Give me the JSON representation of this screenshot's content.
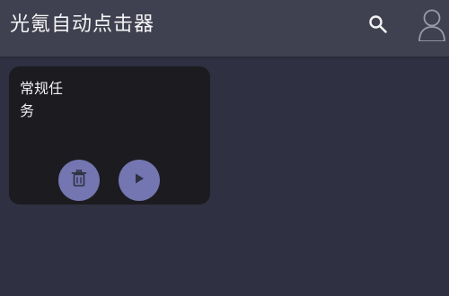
{
  "appbar": {
    "title": "光氪自动点击器",
    "search_icon": "search-icon",
    "account_icon": "account-icon"
  },
  "tasks": [
    {
      "title": "常规任务",
      "actions": [
        "delete-icon",
        "play-icon"
      ]
    }
  ],
  "colors": {
    "background": "#2f3041",
    "appbar": "#404150",
    "card": "#1c1b20",
    "button": "#7376b0",
    "text": "#f0f0f2"
  }
}
